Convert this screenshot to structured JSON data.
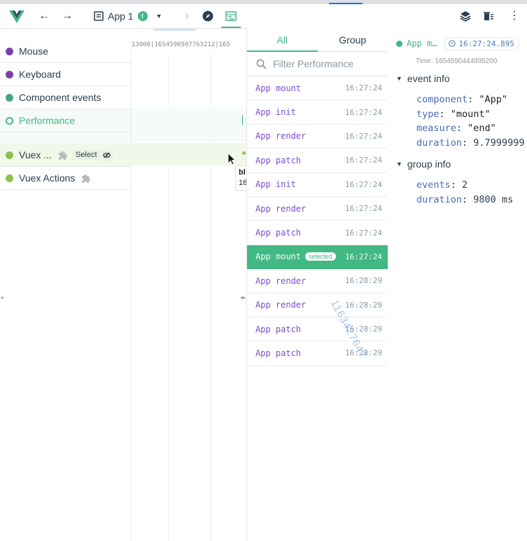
{
  "toolbar": {
    "app_label": "App 1",
    "app_badge": "!",
    "colors": {
      "accent": "#42b883",
      "text": "#2c3e50"
    }
  },
  "layers": [
    {
      "label": "Mouse",
      "color": "#7c3fa8",
      "state": "normal"
    },
    {
      "label": "Keyboard",
      "color": "#7c3fa8",
      "state": "normal"
    },
    {
      "label": "Component events",
      "color": "#41a77a",
      "state": "normal"
    },
    {
      "label": "Performance",
      "color": "#42b883",
      "state": "active"
    },
    {
      "label": "Vuex ...",
      "color": "#8bc34a",
      "state": "hover",
      "chip": "Select"
    },
    {
      "label": "Vuex Actions",
      "color": "#8bc34a",
      "state": "normal"
    }
  ],
  "timeline": {
    "ruler_text": "13000|1654590507763212|165",
    "tooltip_title": "bl",
    "tooltip_time": "16"
  },
  "events_panel": {
    "tabs": [
      {
        "label": "All",
        "selected": true
      },
      {
        "label": "Group",
        "selected": false
      }
    ],
    "filter_placeholder": "Filter Performance",
    "selected_badge": "selected",
    "events": [
      {
        "label": "App mount",
        "time": "16:27:24"
      },
      {
        "label": "App init",
        "time": "16:27:24"
      },
      {
        "label": "App render",
        "time": "16:27:24"
      },
      {
        "label": "App patch",
        "time": "16:27:24"
      },
      {
        "label": "App init",
        "time": "16:27:24"
      },
      {
        "label": "App render",
        "time": "16:27:24"
      },
      {
        "label": "App patch",
        "time": "16:27:24"
      },
      {
        "label": "App mount",
        "time": "16:27:24",
        "selected": true
      },
      {
        "label": "App render",
        "time": "16:28:29"
      },
      {
        "label": "App render",
        "time": "16:28:29"
      },
      {
        "label": "App patch",
        "time": "16:28:29"
      },
      {
        "label": "App patch",
        "time": "16:28:29"
      }
    ]
  },
  "watermark": "1163427647",
  "inspector": {
    "title": "App m…",
    "time_chip": "16:27:24.895",
    "time_line": "Time: 1654590444895200",
    "event_info": {
      "header": "event info",
      "component_key": "component",
      "component_val": "\"App\"",
      "type_key": "type",
      "type_val": "\"mount\"",
      "measure_key": "measure",
      "measure_val": "\"end\"",
      "duration_key": "duration",
      "duration_val": "9.7999999"
    },
    "group_info": {
      "header": "group info",
      "events_key": "events",
      "events_val": "2",
      "duration_key": "duration",
      "duration_val": "9800 ms"
    }
  }
}
